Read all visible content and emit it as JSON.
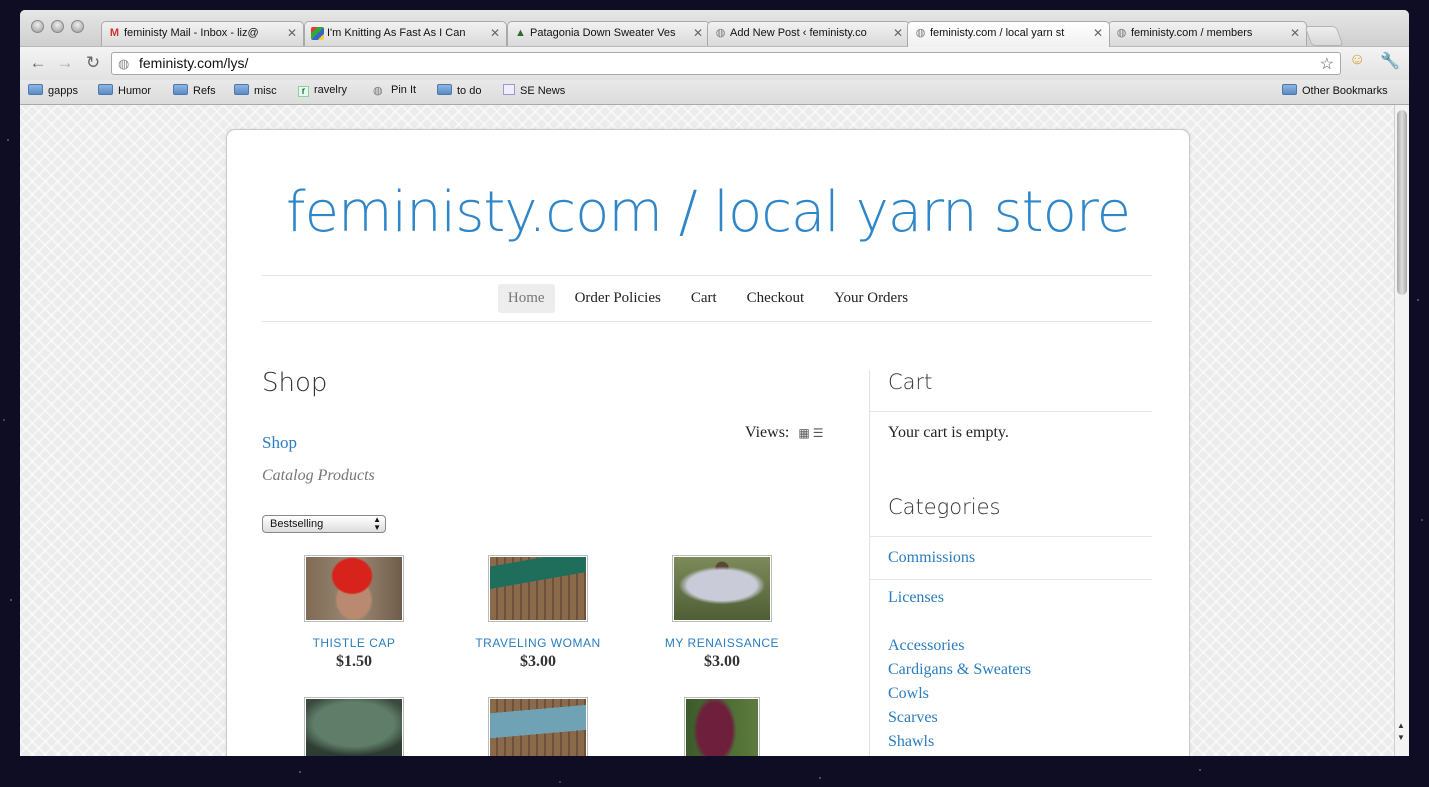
{
  "browser": {
    "tabs": [
      {
        "icon": "gmail-icon",
        "title": "feministy Mail - Inbox - liz@",
        "active": false
      },
      {
        "icon": "google-plus-icon",
        "title": "I'm Knitting As Fast As I Can",
        "active": false
      },
      {
        "icon": "tree-icon",
        "title": "Patagonia Down Sweater Ves",
        "active": false
      },
      {
        "icon": "globe-icon",
        "title": "Add New Post ‹ feministy.co",
        "active": false
      },
      {
        "icon": "globe-icon",
        "title": "feministy.com / local yarn st",
        "active": true
      },
      {
        "icon": "globe-icon",
        "title": "feministy.com / members",
        "active": false
      }
    ],
    "url": "feministy.com/lys/",
    "bookmarks": [
      {
        "icon": "folder-icon",
        "label": "gapps"
      },
      {
        "icon": "folder-icon",
        "label": "Humor"
      },
      {
        "icon": "folder-icon",
        "label": "Refs"
      },
      {
        "icon": "folder-icon",
        "label": "misc"
      },
      {
        "icon": "ravelry-icon",
        "label": "ravelry"
      },
      {
        "icon": "globe-icon",
        "label": "Pin It"
      },
      {
        "icon": "folder-icon",
        "label": "to do"
      },
      {
        "icon": "news-icon",
        "label": "SE News"
      }
    ],
    "other_bookmarks": "Other Bookmarks"
  },
  "site": {
    "title": "feministy.com / local yarn store",
    "accent": "#2f86c8",
    "nav": [
      "Home",
      "Order Policies",
      "Cart",
      "Checkout",
      "Your Orders"
    ]
  },
  "shop": {
    "heading": "Shop",
    "breadcrumb": "Shop",
    "subheading": "Catalog Products",
    "views_label": "Views:",
    "sort": "Bestselling",
    "products": [
      {
        "name": "THISTLE CAP",
        "price": "$1.50"
      },
      {
        "name": "TRAVELING WOMAN",
        "price": "$3.00"
      },
      {
        "name": "MY RENAISSANCE",
        "price": "$3.00"
      },
      {
        "name": "",
        "price": ""
      },
      {
        "name": "",
        "price": ""
      },
      {
        "name": "",
        "price": ""
      }
    ]
  },
  "sidebar": {
    "cart_heading": "Cart",
    "cart_text": "Your cart is empty.",
    "categories_heading": "Categories",
    "categories": [
      "Commissions",
      "Licenses",
      "Accessories",
      "Cardigans & Sweaters",
      "Cowls",
      "Scarves",
      "Shawls"
    ]
  }
}
